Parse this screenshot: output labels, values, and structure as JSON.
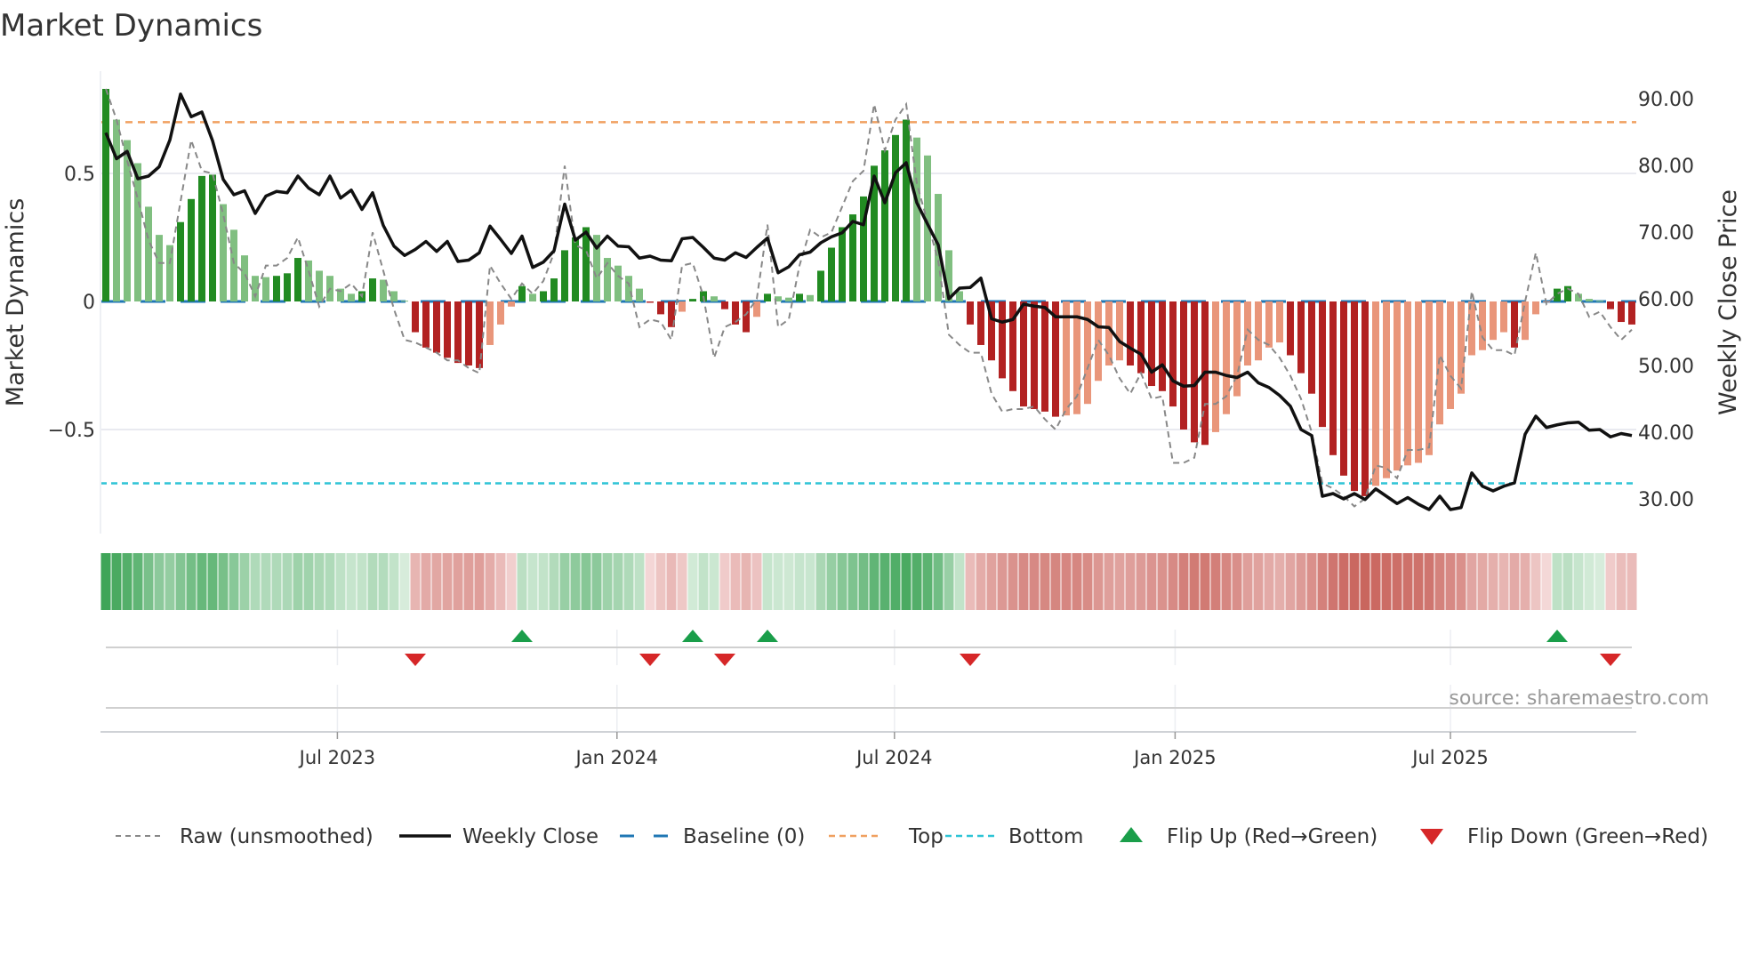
{
  "title": "Market Dynamics",
  "source": "source: sharemaestro.com",
  "colors": {
    "pos_strong": "#228b22",
    "pos_weak": "#80bf80",
    "neg_strong": "#b22222",
    "neg_weak": "#e9967a",
    "raw": "#888888",
    "close": "#111111",
    "baseline": "#1f77b4",
    "top": "#f0a060",
    "bottom": "#2ec4d6",
    "flip_up": "#1a9e4a",
    "flip_down": "#d62728"
  },
  "chart_data": {
    "type": "bar",
    "title": "Market Dynamics",
    "ylabel": "Market Dynamics",
    "y2label": "Weekly Close Price",
    "ylim": [
      -0.92,
      0.9
    ],
    "y2lim": [
      25,
      94
    ],
    "yticks": [
      {
        "v": 0.5,
        "label": "0.5"
      },
      {
        "v": 0,
        "label": "0"
      },
      {
        "v": -0.5,
        "label": "−0.5"
      }
    ],
    "y2ticks": [
      {
        "v": 90,
        "label": "90.00"
      },
      {
        "v": 80,
        "label": "80.00"
      },
      {
        "v": 70,
        "label": "70.00"
      },
      {
        "v": 60,
        "label": "60.00"
      },
      {
        "v": 50,
        "label": "50.00"
      },
      {
        "v": 40,
        "label": "40.00"
      },
      {
        "v": 30,
        "label": "30.00"
      }
    ],
    "xticks": [
      {
        "at": 21.7,
        "label": "Jul 2023"
      },
      {
        "at": 47.9,
        "label": "Jan 2024"
      },
      {
        "at": 73.9,
        "label": "Jul 2024"
      },
      {
        "at": 100.2,
        "label": "Jan 2025"
      },
      {
        "at": 126.0,
        "label": "Jul 2025"
      }
    ],
    "top_level": 0.7,
    "bottom_level": -0.71,
    "baseline": 0,
    "momentum": [
      0.83,
      0.71,
      0.63,
      0.54,
      0.37,
      0.26,
      0.22,
      0.31,
      0.4,
      0.49,
      0.495,
      0.38,
      0.28,
      0.18,
      0.1,
      0.095,
      0.1,
      0.11,
      0.17,
      0.16,
      0.12,
      0.1,
      0.05,
      0.03,
      0.04,
      0.09,
      0.085,
      0.04,
      0.003,
      -0.12,
      -0.18,
      -0.2,
      -0.22,
      -0.24,
      -0.25,
      -0.26,
      -0.17,
      -0.09,
      -0.02,
      0.06,
      0.03,
      0.04,
      0.09,
      0.2,
      0.25,
      0.29,
      0.26,
      0.17,
      0.14,
      0.1,
      0.05,
      -0.005,
      -0.05,
      -0.1,
      -0.04,
      0.01,
      0.04,
      0.02,
      -0.03,
      -0.09,
      -0.12,
      -0.06,
      0.03,
      0.02,
      0.015,
      0.03,
      0.025,
      0.12,
      0.21,
      0.29,
      0.34,
      0.41,
      0.53,
      0.59,
      0.65,
      0.71,
      0.64,
      0.57,
      0.42,
      0.2,
      0.04,
      -0.09,
      -0.17,
      -0.23,
      -0.3,
      -0.35,
      -0.41,
      -0.42,
      -0.43,
      -0.45,
      -0.445,
      -0.44,
      -0.4,
      -0.31,
      -0.25,
      -0.23,
      -0.25,
      -0.28,
      -0.33,
      -0.35,
      -0.41,
      -0.5,
      -0.55,
      -0.56,
      -0.51,
      -0.44,
      -0.37,
      -0.25,
      -0.23,
      -0.18,
      -0.16,
      -0.21,
      -0.28,
      -0.36,
      -0.49,
      -0.6,
      -0.68,
      -0.74,
      -0.76,
      -0.72,
      -0.69,
      -0.66,
      -0.64,
      -0.63,
      -0.6,
      -0.48,
      -0.42,
      -0.36,
      -0.21,
      -0.19,
      -0.15,
      -0.12,
      -0.18,
      -0.15,
      -0.05,
      -0.003,
      0.05,
      0.06,
      0.03,
      0.01,
      0.003,
      -0.03,
      -0.08,
      -0.09
    ],
    "raw": [
      0.83,
      0.71,
      0.55,
      0.4,
      0.24,
      0.15,
      0.15,
      0.39,
      0.63,
      0.51,
      0.5,
      0.34,
      0.15,
      0.11,
      0.02,
      0.14,
      0.14,
      0.17,
      0.25,
      0.12,
      -0.02,
      0.05,
      0.04,
      0.07,
      0.02,
      0.27,
      0.12,
      -0.03,
      -0.15,
      -0.16,
      -0.18,
      -0.2,
      -0.23,
      -0.23,
      -0.26,
      -0.28,
      0.14,
      0.07,
      0.01,
      0.07,
      0.03,
      0.08,
      0.19,
      0.53,
      0.22,
      0.2,
      0.09,
      0.15,
      0.1,
      0.07,
      -0.1,
      -0.07,
      -0.08,
      -0.15,
      0.14,
      0.15,
      0.02,
      -0.22,
      -0.1,
      -0.08,
      -0.05,
      0.01,
      0.3,
      -0.1,
      -0.07,
      0.14,
      0.28,
      0.25,
      0.27,
      0.37,
      0.47,
      0.51,
      0.77,
      0.59,
      0.71,
      0.77,
      0.46,
      0.31,
      0.16,
      -0.13,
      -0.17,
      -0.2,
      -0.2,
      -0.36,
      -0.43,
      -0.42,
      -0.42,
      -0.41,
      -0.46,
      -0.5,
      -0.42,
      -0.37,
      -0.26,
      -0.15,
      -0.21,
      -0.3,
      -0.36,
      -0.28,
      -0.38,
      -0.37,
      -0.63,
      -0.63,
      -0.61,
      -0.4,
      -0.4,
      -0.37,
      -0.29,
      -0.11,
      -0.15,
      -0.17,
      -0.22,
      -0.29,
      -0.38,
      -0.51,
      -0.71,
      -0.73,
      -0.76,
      -0.8,
      -0.77,
      -0.64,
      -0.65,
      -0.69,
      -0.58,
      -0.58,
      -0.57,
      -0.21,
      -0.29,
      -0.34,
      0.04,
      -0.14,
      -0.19,
      -0.19,
      -0.21,
      0.0,
      0.19,
      -0.01,
      0.03,
      0.05,
      0.03,
      -0.06,
      -0.04,
      -0.1,
      -0.15,
      -0.11
    ],
    "close": [
      84.9,
      81.0,
      82.1,
      78.0,
      78.4,
      79.8,
      83.8,
      90.7,
      87.3,
      88.0,
      83.7,
      77.9,
      75.6,
      76.2,
      72.8,
      75.4,
      76.1,
      75.9,
      78.4,
      76.6,
      75.6,
      78.4,
      75.1,
      76.3,
      73.4,
      75.9,
      71.0,
      67.9,
      66.5,
      67.4,
      68.6,
      67.1,
      68.6,
      65.6,
      65.8,
      66.9,
      70.9,
      68.9,
      66.8,
      69.4,
      64.7,
      65.5,
      67.2,
      74.2,
      68.8,
      70.0,
      67.6,
      69.4,
      67.9,
      67.8,
      66.1,
      66.4,
      65.8,
      65.7,
      69.0,
      69.2,
      67.7,
      66.1,
      65.8,
      66.9,
      66.2,
      67.7,
      69.1,
      63.9,
      64.8,
      66.6,
      67.0,
      68.4,
      69.3,
      69.9,
      71.6,
      71.1,
      78.4,
      74.4,
      78.9,
      80.4,
      74.4,
      71.2,
      68.1,
      60.0,
      61.6,
      61.7,
      63.1,
      57.0,
      56.5,
      56.9,
      59.2,
      58.9,
      58.7,
      57.3,
      57.3,
      57.3,
      56.9,
      55.8,
      55.7,
      53.6,
      52.6,
      51.7,
      49.0,
      50.1,
      47.7,
      46.9,
      47.0,
      49.0,
      49.0,
      48.5,
      48.2,
      49.0,
      47.4,
      46.7,
      45.5,
      43.9,
      40.4,
      39.5,
      30.4,
      30.8,
      30.0,
      30.8,
      29.9,
      31.5,
      30.4,
      29.3,
      30.2,
      29.2,
      28.4,
      30.4,
      28.4,
      28.7,
      33.9,
      31.9,
      31.2,
      31.9,
      32.4,
      39.7,
      42.4,
      40.7,
      41.1,
      41.4,
      41.5,
      40.3,
      40.4,
      39.3,
      39.8,
      39.5
    ],
    "flips": [
      {
        "i": 29,
        "dir": "down"
      },
      {
        "i": 39,
        "dir": "up"
      },
      {
        "i": 51,
        "dir": "down"
      },
      {
        "i": 55,
        "dir": "up"
      },
      {
        "i": 58,
        "dir": "down"
      },
      {
        "i": 62,
        "dir": "up"
      },
      {
        "i": 81,
        "dir": "down"
      },
      {
        "i": 136,
        "dir": "up"
      },
      {
        "i": 141,
        "dir": "down"
      }
    ],
    "legend_position": "bottom",
    "legend": [
      {
        "key": "raw",
        "label": "Raw (unsmoothed)"
      },
      {
        "key": "close",
        "label": "Weekly Close"
      },
      {
        "key": "baseline",
        "label": "Baseline (0)"
      },
      {
        "key": "top",
        "label": "Top"
      },
      {
        "key": "bottom",
        "label": "Bottom"
      },
      {
        "key": "flip_up",
        "label": "Flip Up (Red→Green)"
      },
      {
        "key": "flip_down",
        "label": "Flip Down (Green→Red)"
      }
    ]
  }
}
